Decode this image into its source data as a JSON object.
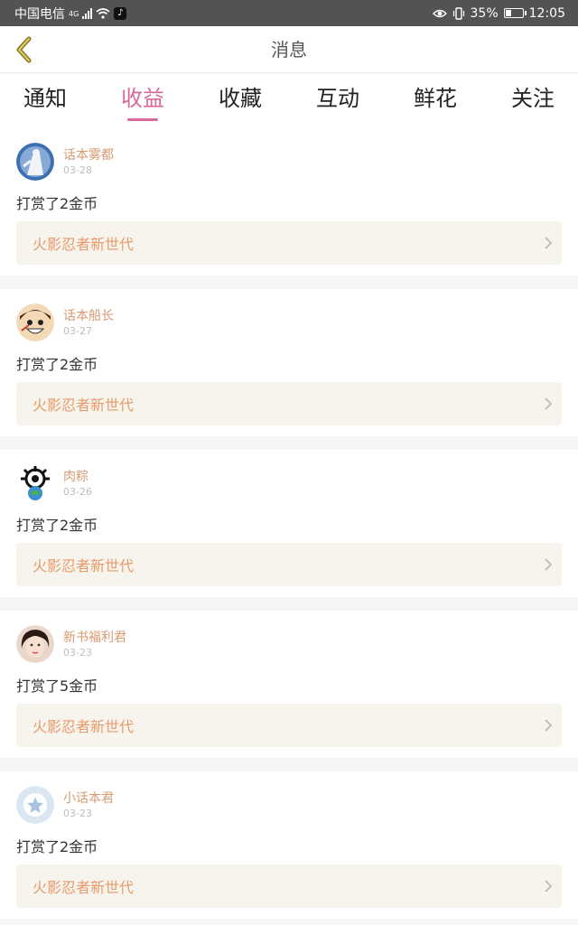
{
  "status_bar": {
    "carrier": "中国电信",
    "network": "4G",
    "battery": "35%",
    "time": "12:05"
  },
  "header": {
    "title": "消息",
    "back_icon": "chevron-left-icon"
  },
  "tabs": [
    {
      "label": "通知",
      "active": false
    },
    {
      "label": "收益",
      "active": true
    },
    {
      "label": "收藏",
      "active": false
    },
    {
      "label": "互动",
      "active": false
    },
    {
      "label": "鲜花",
      "active": false
    },
    {
      "label": "关注",
      "active": false
    }
  ],
  "colors": {
    "accent": "#d8689a",
    "username": "#d69a70",
    "book_title": "#e89a6a",
    "book_bg": "#f6f4ec"
  },
  "messages": [
    {
      "user": "话本雾都",
      "date": "03-28",
      "action": "打赏了2金币",
      "book": "火影忍者新世代",
      "avatar": "avatar-blue-figure"
    },
    {
      "user": "话本船长",
      "date": "03-27",
      "action": "打赏了2金币",
      "book": "火影忍者新世代",
      "avatar": "avatar-cartoon-face"
    },
    {
      "user": "肉粽",
      "date": "03-26",
      "action": "打赏了2金币",
      "book": "火影忍者新世代",
      "avatar": "avatar-globe-emblem"
    },
    {
      "user": "新书福利君",
      "date": "03-23",
      "action": "打赏了5金币",
      "book": "火影忍者新世代",
      "avatar": "avatar-girl-photo"
    },
    {
      "user": "小话本君",
      "date": "03-23",
      "action": "打赏了2金币",
      "book": "火影忍者新世代",
      "avatar": "avatar-default-star"
    }
  ]
}
